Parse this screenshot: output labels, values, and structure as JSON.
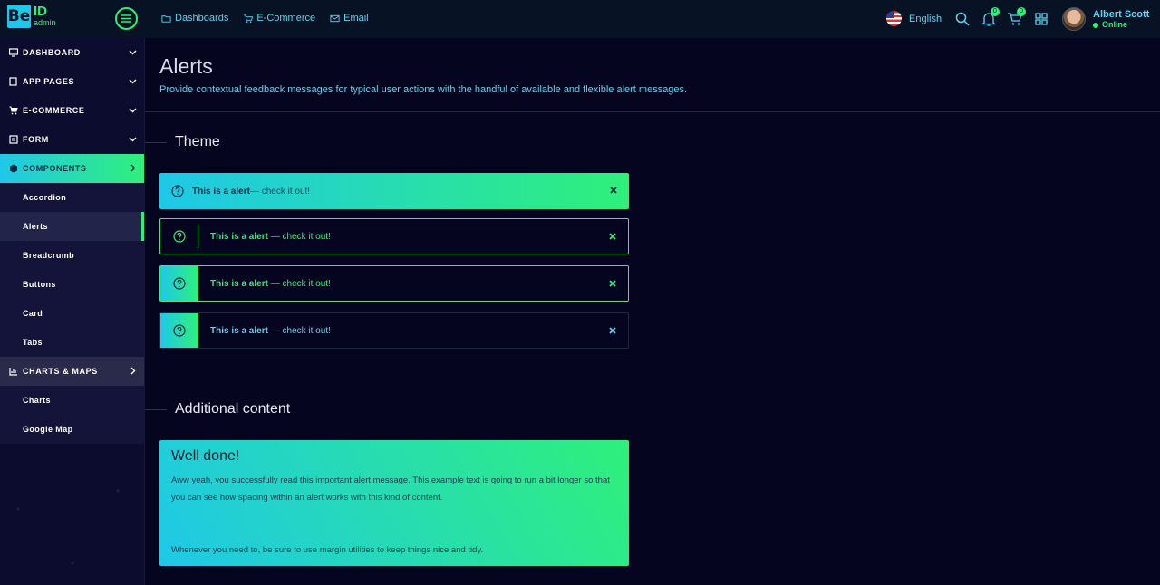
{
  "brand": {
    "box": "Be",
    "id": "ID",
    "sub": "admin"
  },
  "topnav": [
    {
      "label": "Dashboards",
      "icon": "folder-icon"
    },
    {
      "label": "E-Commerce",
      "icon": "cart-icon"
    },
    {
      "label": "Email",
      "icon": "mail-icon"
    }
  ],
  "language": "English",
  "notifications_count": "0",
  "cart_count": "0",
  "user": {
    "name": "Albert Scott",
    "status": "Online"
  },
  "sidebar": {
    "dashboard": "DASHBOARD",
    "app_pages": "APP PAGES",
    "ecommerce": "E-COMMERCE",
    "form": "FORM",
    "components": "COMPONENTS",
    "components_items": [
      "Accordion",
      "Alerts",
      "Breadcrumb",
      "Buttons",
      "Card",
      "Tabs"
    ],
    "charts_maps": "CHARTS & MAPS",
    "charts_items": [
      "Charts",
      "Google Map"
    ]
  },
  "page": {
    "title": "Alerts",
    "subtitle": "Provide contextual feedback messages for typical user actions with the handful of available and flexible alert messages."
  },
  "theme": {
    "title": "Theme",
    "alert1": {
      "strong": "This is a alert",
      "rest": "— check it out!"
    },
    "alert2": {
      "strong": "This is a alert",
      "rest": " — check it out!"
    },
    "alert3": {
      "strong": "This is a alert",
      "rest": " — check it out!"
    },
    "alert4": {
      "strong": "This is a alert",
      "rest": " — check it out!"
    }
  },
  "additional": {
    "title": "Additional content",
    "heading": "Well done!",
    "body": "Aww yeah, you successfully read this important alert message. This example text is going to run a bit longer so that you can see how spacing within an alert works with this kind of content.",
    "footer": "Whenever you need to, be sure to use margin utilities to keep things nice and tidy."
  },
  "colors": {
    "accent_green": "#2ff07a",
    "accent_cyan": "#1fc8e8",
    "background": "#050520"
  }
}
